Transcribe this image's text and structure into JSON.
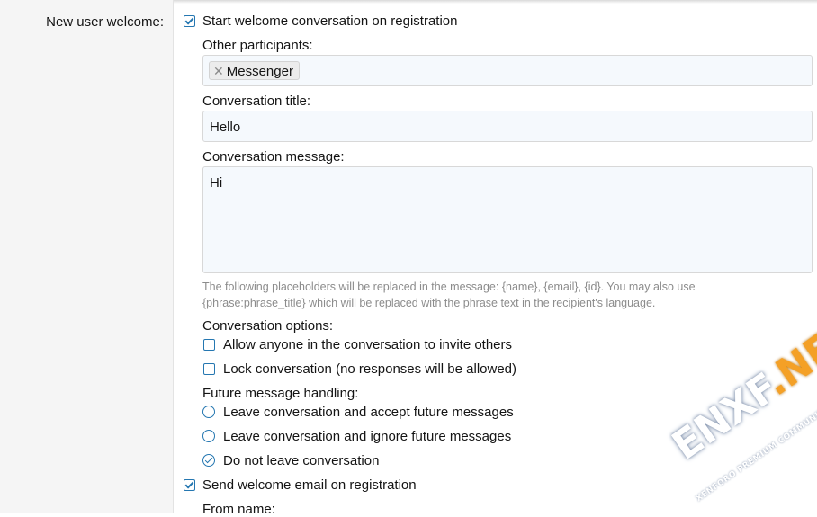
{
  "row_label": "New user welcome:",
  "start_conversation": {
    "label": "Start welcome conversation on registration",
    "checked": true
  },
  "participants": {
    "label": "Other participants:",
    "tags": [
      "Messenger"
    ]
  },
  "conversation_title": {
    "label": "Conversation title:",
    "value": "Hello"
  },
  "conversation_message": {
    "label": "Conversation message:",
    "value": "Hi"
  },
  "hint": {
    "line1": "The following placeholders will be replaced in the message: {name}, {email}, {id}. You may also use",
    "line2": "{phrase:phrase_title} which will be replaced with the phrase text in the recipient's language."
  },
  "conversation_options": {
    "label": "Conversation options:",
    "items": [
      {
        "label": "Allow anyone in the conversation to invite others",
        "checked": false
      },
      {
        "label": "Lock conversation (no responses will be allowed)",
        "checked": false
      }
    ]
  },
  "future_handling": {
    "label": "Future message handling:",
    "options": [
      {
        "label": "Leave conversation and accept future messages",
        "selected": false
      },
      {
        "label": "Leave conversation and ignore future messages",
        "selected": false
      },
      {
        "label": "Do not leave conversation",
        "selected": true
      }
    ]
  },
  "send_email": {
    "label": "Send welcome email on registration",
    "checked": true
  },
  "from_name": {
    "label": "From name:"
  },
  "watermark": {
    "main": "ENXF",
    "accent": ".NET",
    "sub": "XENFORO PREMIUM COMMUNITY"
  },
  "colors": {
    "accent": "#2577b1",
    "field_bg": "#f5f9fd",
    "label_column_bg": "#f5f5f5",
    "hint": "#8c8c8c"
  }
}
